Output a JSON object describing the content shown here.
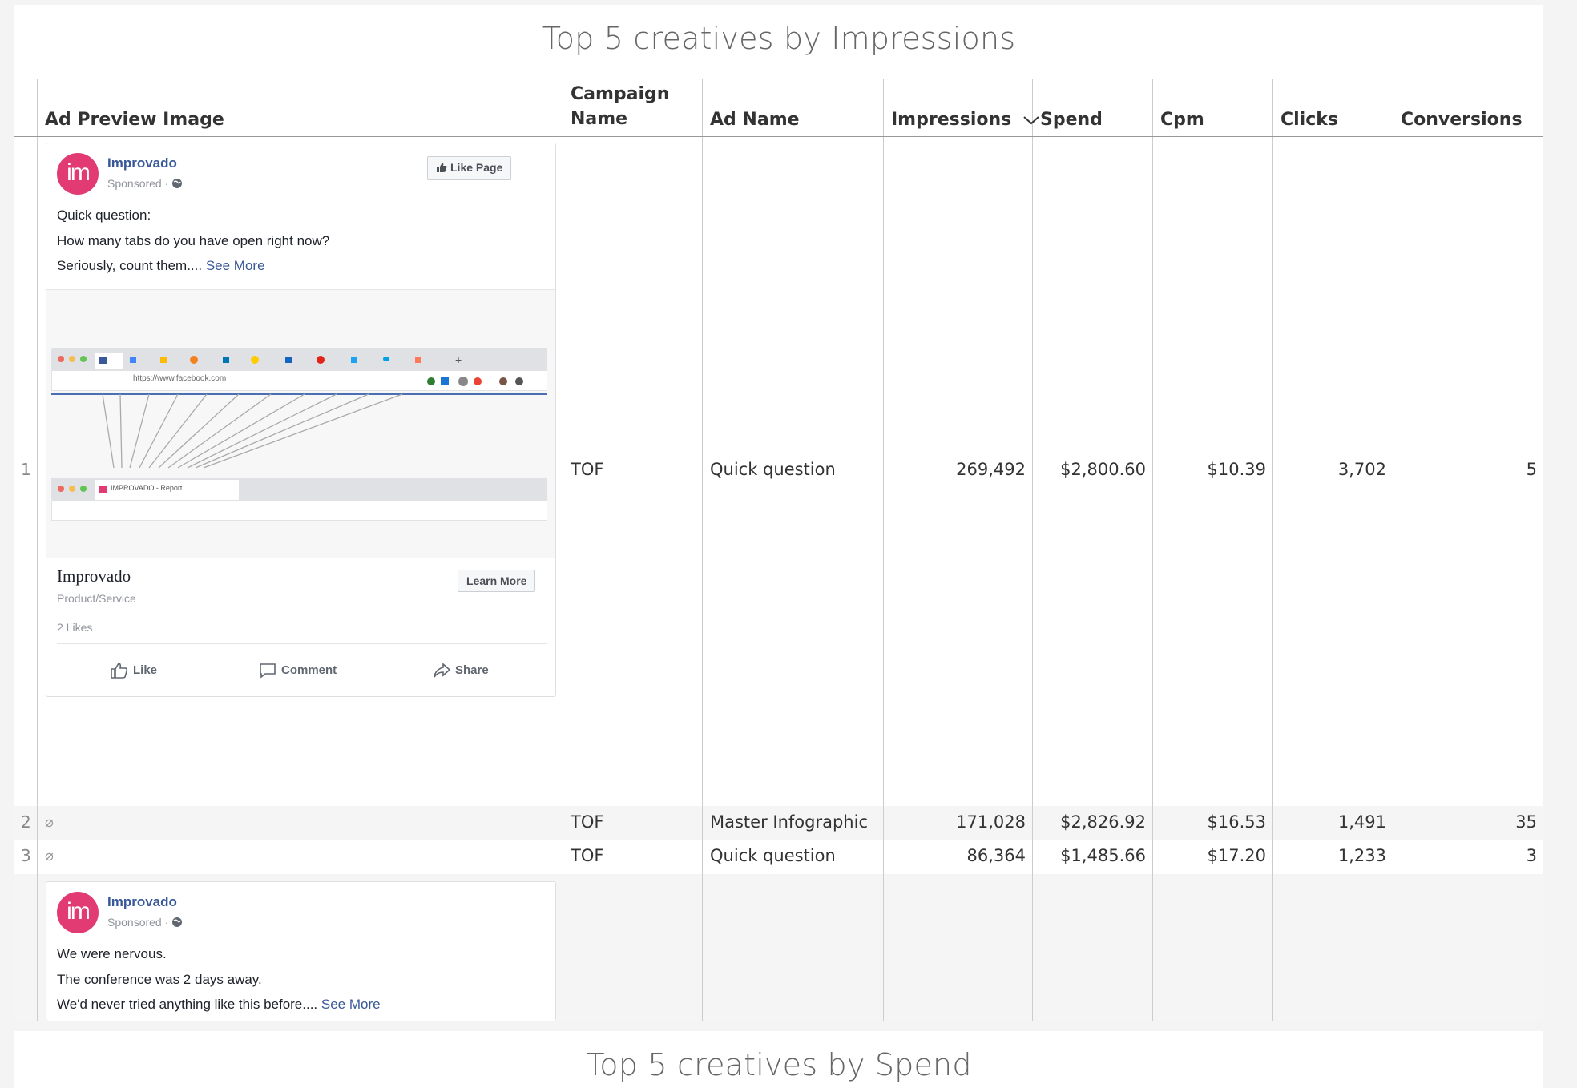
{
  "panel1": {
    "title": "Top 5 creatives by Impressions",
    "columns": {
      "ad_preview_image": "Ad Preview Image",
      "campaign_name_line1": "Campaign",
      "campaign_name_line2": "Name",
      "ad_name": "Ad Name",
      "impressions": "Impressions",
      "spend": "Spend",
      "cpm": "Cpm",
      "clicks": "Clicks",
      "conversions": "Conversions"
    },
    "rows": [
      {
        "index": "1",
        "campaign": "TOF",
        "ad_name": "Quick question",
        "impressions": "269,492",
        "spend": "$2,800.60",
        "cpm": "$10.39",
        "clicks": "3,702",
        "conversions": "5"
      },
      {
        "index": "2",
        "preview": "⌀",
        "campaign": "TOF",
        "ad_name": "Master Infographic",
        "impressions": "171,028",
        "spend": "$2,826.92",
        "cpm": "$16.53",
        "clicks": "1,491",
        "conversions": "35"
      },
      {
        "index": "3",
        "preview": "⌀",
        "campaign": "TOF",
        "ad_name": "Quick question",
        "impressions": "86,364",
        "spend": "$1,485.66",
        "cpm": "$17.20",
        "clicks": "1,233",
        "conversions": "3"
      }
    ],
    "ad1": {
      "avatar": "im",
      "page_name": "Improvado",
      "sponsored": "Sponsored · ",
      "like_page": "Like Page",
      "line1": "Quick question:",
      "line2": "How many tabs do you have open right now?",
      "line3": "Seriously, count them.... ",
      "see_more": "See More",
      "url_text": "https://www.facebook.com",
      "tab_text": "IMPROVADO - Report",
      "brand": "Improvado",
      "category": "Product/Service",
      "likes": "2 Likes",
      "learn_more": "Learn More",
      "action_like": "Like",
      "action_comment": "Comment",
      "action_share": "Share"
    },
    "ad4": {
      "avatar": "im",
      "page_name": "Improvado",
      "sponsored": "Sponsored · ",
      "line1": "We were nervous.",
      "line2": "The conference was 2 days away.",
      "line3": "We'd never tried anything like this before.... ",
      "see_more": "See More"
    }
  },
  "panel2": {
    "title": "Top 5 creatives by Spend"
  },
  "colors": {
    "avatar": "#e23b74",
    "fb_link": "#385898",
    "stripe": "#f5f5f5"
  }
}
